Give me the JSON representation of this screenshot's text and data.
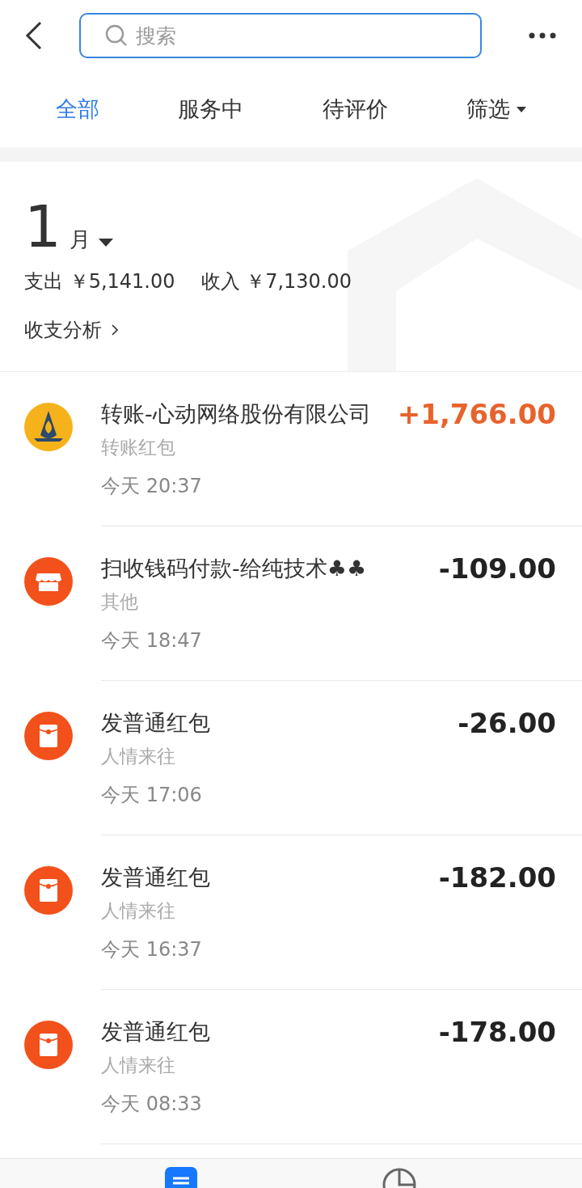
{
  "search": {
    "placeholder": "搜索"
  },
  "tabs": [
    {
      "label": "全部",
      "selected": true
    },
    {
      "label": "服务中",
      "selected": false
    },
    {
      "label": "待评价",
      "selected": false
    },
    {
      "label": "筛选",
      "selected": false,
      "dropdown": true
    }
  ],
  "summary": {
    "month_number": "1",
    "month_unit": "月",
    "expense_label": "支出",
    "expense": "￥5,141.00",
    "income_label": "收入",
    "income": "￥7,130.00",
    "analysis_link": "收支分析"
  },
  "transactions": [
    {
      "kind": "transfer",
      "title": "转账-心动网络股份有限公司",
      "category": "转账红包",
      "time": "今天 20:37",
      "amount": "+1,766.00",
      "income": true
    },
    {
      "kind": "shop",
      "title": "扫收钱码付款-给纯技术♣♣",
      "category": "其他",
      "time": "今天 18:47",
      "amount": "-109.00",
      "income": false
    },
    {
      "kind": "red-packet",
      "title": "发普通红包",
      "category": "人情来往",
      "time": "今天 17:06",
      "amount": "-26.00",
      "income": false
    },
    {
      "kind": "red-packet",
      "title": "发普通红包",
      "category": "人情来往",
      "time": "今天 16:37",
      "amount": "-182.00",
      "income": false
    },
    {
      "kind": "red-packet",
      "title": "发普通红包",
      "category": "人情来往",
      "time": "今天 08:33",
      "amount": "-178.00",
      "income": false
    }
  ],
  "bottom_tabs": [
    {
      "kind": "list",
      "selected": true
    },
    {
      "kind": "chart",
      "selected": false
    }
  ]
}
